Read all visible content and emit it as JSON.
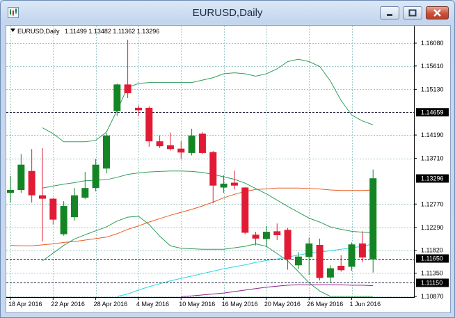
{
  "window": {
    "title": "EURUSD,Daily",
    "buttons": [
      "minimize",
      "maximize",
      "close"
    ]
  },
  "header": {
    "symbol": "EURUSD,Daily",
    "ohlc": "1.11499 1.13482 1.11362 1.13296"
  },
  "colors": {
    "up": "#148524",
    "down": "#e11b35",
    "grid": "#9fc7c7",
    "bands": "#2f9e5a",
    "ma_orange": "#ec5a1f",
    "ma_cyan": "#26d6e6",
    "ma_purple": "#8a1f8f"
  },
  "chart_data": {
    "type": "candlestick",
    "symbol": "EURUSD",
    "timeframe": "Daily",
    "ylim": [
      1.1087,
      1.1608
    ],
    "ytick_labels": [
      "1.16080",
      "1.15610",
      "1.15130",
      "1.14190",
      "1.13710",
      "1.12770",
      "1.12290",
      "1.11820",
      "1.11350",
      "1.10870"
    ],
    "xtick_labels": [
      "18 Apr 2016",
      "22 Apr 2016",
      "28 Apr 2016",
      "4 May 2016",
      "10 May 2016",
      "16 May 2016",
      "20 May 2016",
      "26 May 2016",
      "1 Jun 2016"
    ],
    "price_markers": [
      {
        "label": "1.14659",
        "value": 1.14659
      },
      {
        "label": "1.13296",
        "value": 1.13296
      },
      {
        "label": "1.11650",
        "value": 1.1165
      },
      {
        "label": "1.11150",
        "value": 1.1115
      }
    ],
    "candles": [
      {
        "o": 1.13,
        "h": 1.1335,
        "l": 1.128,
        "c": 1.1306
      },
      {
        "o": 1.1306,
        "h": 1.138,
        "l": 1.13,
        "c": 1.1358
      },
      {
        "o": 1.1345,
        "h": 1.139,
        "l": 1.128,
        "c": 1.1295
      },
      {
        "o": 1.1295,
        "h": 1.1392,
        "l": 1.12,
        "c": 1.1288
      },
      {
        "o": 1.1288,
        "h": 1.129,
        "l": 1.1235,
        "c": 1.1245
      },
      {
        "o": 1.1215,
        "h": 1.1283,
        "l": 1.1212,
        "c": 1.1273
      },
      {
        "o": 1.125,
        "h": 1.131,
        "l": 1.1243,
        "c": 1.1295
      },
      {
        "o": 1.129,
        "h": 1.1343,
        "l": 1.1287,
        "c": 1.131
      },
      {
        "o": 1.131,
        "h": 1.137,
        "l": 1.1303,
        "c": 1.1358
      },
      {
        "o": 1.135,
        "h": 1.1423,
        "l": 1.134,
        "c": 1.1418
      },
      {
        "o": 1.1468,
        "h": 1.1525,
        "l": 1.1458,
        "c": 1.1523
      },
      {
        "o": 1.1523,
        "h": 1.1615,
        "l": 1.1495,
        "c": 1.1505
      },
      {
        "o": 1.1475,
        "h": 1.148,
        "l": 1.1458,
        "c": 1.147
      },
      {
        "o": 1.1475,
        "h": 1.1478,
        "l": 1.1395,
        "c": 1.1406
      },
      {
        "o": 1.1406,
        "h": 1.1418,
        "l": 1.1392,
        "c": 1.1396
      },
      {
        "o": 1.1398,
        "h": 1.1424,
        "l": 1.1387,
        "c": 1.139
      },
      {
        "o": 1.1391,
        "h": 1.1406,
        "l": 1.137,
        "c": 1.1383
      },
      {
        "o": 1.1382,
        "h": 1.1432,
        "l": 1.1377,
        "c": 1.1418
      },
      {
        "o": 1.1422,
        "h": 1.1425,
        "l": 1.138,
        "c": 1.1382
      },
      {
        "o": 1.1384,
        "h": 1.1386,
        "l": 1.1279,
        "c": 1.1315
      },
      {
        "o": 1.1311,
        "h": 1.1336,
        "l": 1.13,
        "c": 1.1319
      },
      {
        "o": 1.1321,
        "h": 1.1346,
        "l": 1.1307,
        "c": 1.1315
      },
      {
        "o": 1.1311,
        "h": 1.1312,
        "l": 1.1215,
        "c": 1.1218
      },
      {
        "o": 1.1214,
        "h": 1.122,
        "l": 1.1192,
        "c": 1.1206
      },
      {
        "o": 1.1205,
        "h": 1.1232,
        "l": 1.1188,
        "c": 1.122
      },
      {
        "o": 1.1221,
        "h": 1.1237,
        "l": 1.1203,
        "c": 1.1213
      },
      {
        "o": 1.1224,
        "h": 1.1228,
        "l": 1.1142,
        "c": 1.1163
      },
      {
        "o": 1.1151,
        "h": 1.1178,
        "l": 1.1143,
        "c": 1.1169
      },
      {
        "o": 1.1168,
        "h": 1.1208,
        "l": 1.1131,
        "c": 1.1196
      },
      {
        "o": 1.1193,
        "h": 1.1206,
        "l": 1.112,
        "c": 1.1125
      },
      {
        "o": 1.1126,
        "h": 1.1151,
        "l": 1.1116,
        "c": 1.1145
      },
      {
        "o": 1.115,
        "h": 1.1172,
        "l": 1.1138,
        "c": 1.1141
      },
      {
        "o": 1.1148,
        "h": 1.1198,
        "l": 1.114,
        "c": 1.1194
      },
      {
        "o": 1.1196,
        "h": 1.1221,
        "l": 1.1158,
        "c": 1.1167
      },
      {
        "o": 1.1163,
        "h": 1.1348,
        "l": 1.1136,
        "c": 1.133
      }
    ],
    "indicators": {
      "bollinger_upper": [
        null,
        null,
        null,
        1.1434,
        1.1422,
        1.1405,
        1.1405,
        1.1405,
        1.1408,
        1.1425,
        1.147,
        1.1517,
        1.1525,
        1.1527,
        1.1527,
        1.1527,
        1.1527,
        1.1527,
        1.1532,
        1.1537,
        1.1545,
        1.1547,
        1.1545,
        1.154,
        1.1545,
        1.1555,
        1.157,
        1.1575,
        1.157,
        1.156,
        1.153,
        1.149,
        1.146,
        1.1448,
        1.144
      ],
      "bollinger_middle": [
        null,
        null,
        null,
        1.131,
        1.1314,
        1.1318,
        1.1321,
        1.1325,
        1.1326,
        1.1327,
        1.1332,
        1.1338,
        1.1341,
        1.1343,
        1.1344,
        1.1345,
        1.1345,
        1.1344,
        1.1342,
        1.1338,
        1.1333,
        1.1328,
        1.132,
        1.1309,
        1.1298,
        1.1285,
        1.1272,
        1.126,
        1.1248,
        1.124,
        1.123,
        1.1225,
        1.1221,
        1.1219,
        1.1218
      ],
      "bollinger_lower": [
        null,
        null,
        null,
        1.116,
        1.1176,
        1.1192,
        1.1205,
        1.1214,
        1.1222,
        1.123,
        1.1242,
        1.125,
        1.1252,
        1.1235,
        1.1211,
        1.1191,
        1.1186,
        1.1185,
        1.1184,
        1.1184,
        1.1184,
        1.1187,
        1.119,
        1.1195,
        1.119,
        1.1175,
        1.116,
        1.1138,
        1.1115,
        1.1098,
        1.1082,
        1.1074,
        1.1075,
        1.108,
        1.1085
      ],
      "ma_orange": [
        1.1192,
        1.1191,
        1.1191,
        1.1193,
        1.1195,
        1.1198,
        1.12,
        1.1203,
        1.1206,
        1.1209,
        1.1216,
        1.1225,
        1.1232,
        1.124,
        1.1247,
        1.1254,
        1.126,
        1.1266,
        1.1273,
        1.1281,
        1.129,
        1.1297,
        1.1303,
        1.1307,
        1.1308,
        1.131,
        1.131,
        1.131,
        1.1309,
        1.1308,
        1.1306,
        1.1305,
        1.1305,
        1.1305,
        1.1306
      ],
      "ma_cyan": [
        null,
        null,
        null,
        null,
        null,
        null,
        null,
        null,
        null,
        null,
        1.1086,
        1.1092,
        1.11,
        1.1107,
        1.1113,
        1.1119,
        1.1124,
        1.1129,
        1.1134,
        1.1139,
        1.1144,
        1.1148,
        1.1152,
        1.1157,
        1.1161,
        1.1164,
        1.1168,
        1.1172,
        1.1176,
        1.1178,
        1.1181,
        1.1184,
        1.1187,
        1.119,
        1.1195
      ],
      "ma_purple": [
        null,
        null,
        null,
        null,
        null,
        null,
        null,
        null,
        null,
        null,
        null,
        null,
        null,
        null,
        null,
        null,
        1.1086,
        1.1088,
        1.109,
        1.1092,
        1.1094,
        1.1097,
        1.11,
        1.1103,
        1.1106,
        1.1108,
        1.111,
        1.1111,
        1.1111,
        1.1111,
        1.1111,
        1.1111,
        1.111,
        1.111,
        1.1109
      ]
    }
  }
}
